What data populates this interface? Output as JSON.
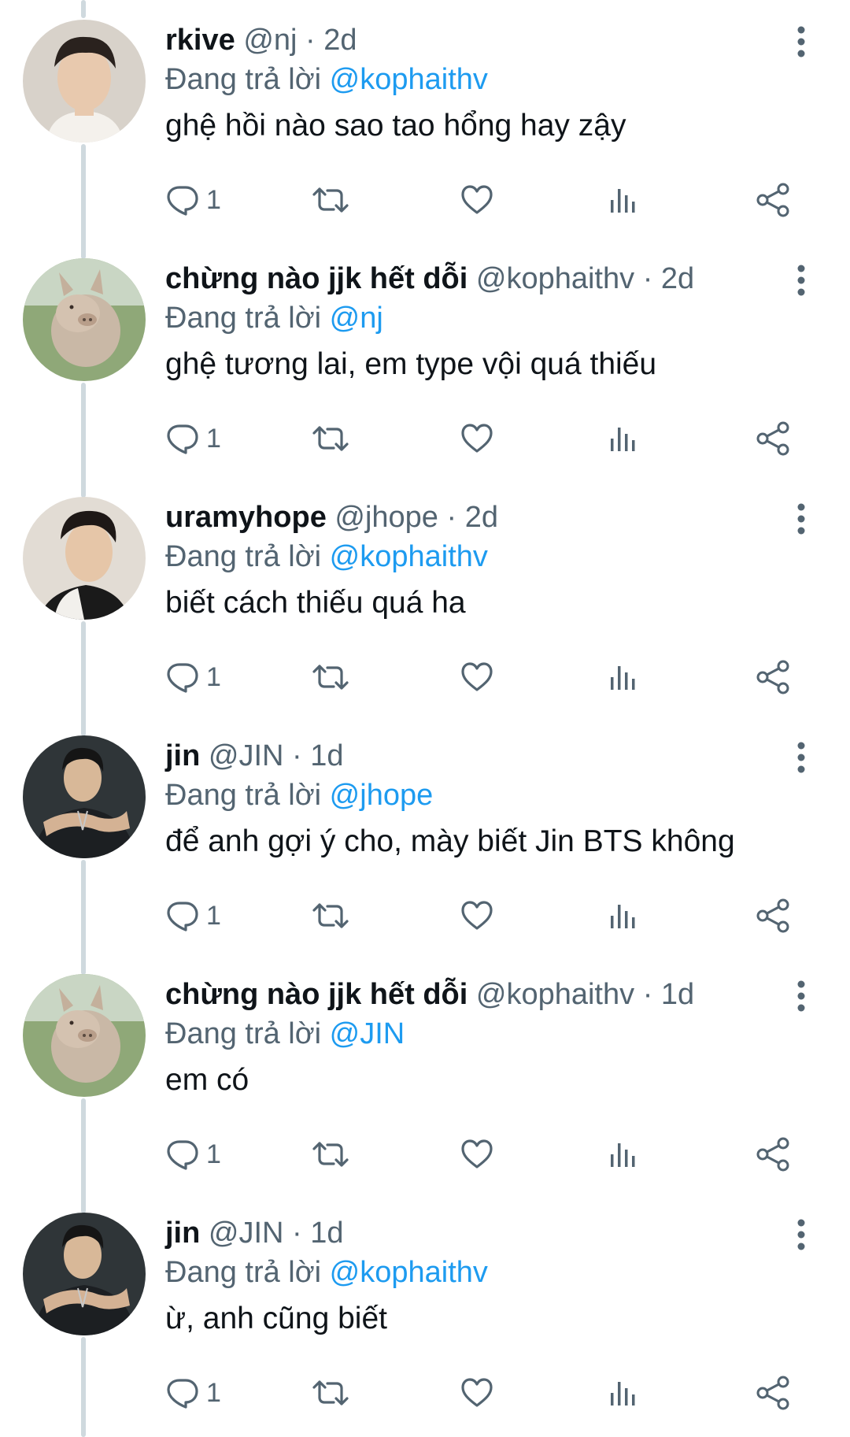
{
  "replies": [
    {
      "name": "rkive",
      "handle": "@nj",
      "sep": "·",
      "time": "2d",
      "replying_prefix": "Đang trả lời",
      "replying_to": "@kophaithv",
      "text": "ghệ hồi nào sao tao hổng hay zậy",
      "reply_count": "1",
      "avatar": "person-avatar"
    },
    {
      "name": "chừng nào jjk hết dỗi",
      "handle": "@kophaithv",
      "sep": "·",
      "time": "2d",
      "replying_prefix": "Đang trả lời",
      "replying_to": "@nj",
      "text": "ghệ tương lai, em type vội quá thiếu",
      "reply_count": "1",
      "avatar": "pig-avatar"
    },
    {
      "name": "uramyhope",
      "handle": "@jhope",
      "sep": "·",
      "time": "2d",
      "replying_prefix": "Đang trả lời",
      "replying_to": "@kophaithv",
      "text": "biết cách thiếu quá ha",
      "reply_count": "1",
      "avatar": "person-avatar"
    },
    {
      "name": "jin",
      "handle": "@JIN",
      "sep": "·",
      "time": "1d",
      "replying_prefix": "Đang trả lời",
      "replying_to": "@jhope",
      "text": "để anh gợi ý cho, mày biết Jin BTS không",
      "reply_count": "1",
      "avatar": "person-dark-avatar"
    },
    {
      "name": "chừng nào jjk hết dỗi",
      "handle": "@kophaithv",
      "sep": "·",
      "time": "1d",
      "replying_prefix": "Đang trả lời",
      "replying_to": "@JIN",
      "text": "em có",
      "reply_count": "1",
      "avatar": "pig-avatar"
    },
    {
      "name": "jin",
      "handle": "@JIN",
      "sep": "·",
      "time": "1d",
      "replying_prefix": "Đang trả lời",
      "replying_to": "@kophaithv",
      "text": "ừ, anh cũng biết",
      "reply_count": "1",
      "avatar": "person-dark-avatar"
    }
  ],
  "colors": {
    "text": "#0f1419",
    "secondary": "#536471",
    "accent": "#1d9bf0",
    "thread_line": "#cfd9de"
  },
  "icons": [
    "reply-icon",
    "retweet-icon",
    "like-icon",
    "views-icon",
    "share-icon",
    "more-icon"
  ]
}
